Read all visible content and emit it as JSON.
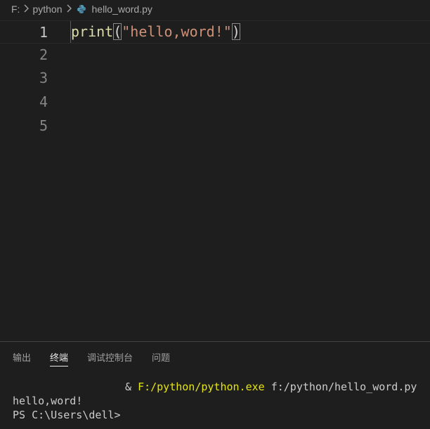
{
  "breadcrumb": {
    "drive": "F:",
    "folder": "python",
    "file": "hello_word.py",
    "separator": ">",
    "file_icon": "python-icon"
  },
  "editor": {
    "lines": [
      {
        "number": "1",
        "fn": "print",
        "open": "(",
        "str": "\"hello,word!\"",
        "close": ")"
      },
      {
        "number": "2"
      },
      {
        "number": "3"
      },
      {
        "number": "4"
      },
      {
        "number": "5"
      }
    ]
  },
  "panel": {
    "tabs": [
      {
        "label": "输出"
      },
      {
        "label": "终端",
        "active": true
      },
      {
        "label": "调试控制台"
      },
      {
        "label": "问题"
      }
    ],
    "terminal": {
      "command_prefix": "& ",
      "command_exe": "F:/python/python.exe",
      "command_arg": " f:/python/hello_word.py",
      "output": "hello,word!",
      "prompt": "PS C:\\Users\\dell>"
    }
  },
  "colors": {
    "background": "#1e1e1e",
    "function": "#dcdcaa",
    "string": "#ce9178",
    "exe": "#e5e510",
    "python_icon": "#519aba"
  }
}
